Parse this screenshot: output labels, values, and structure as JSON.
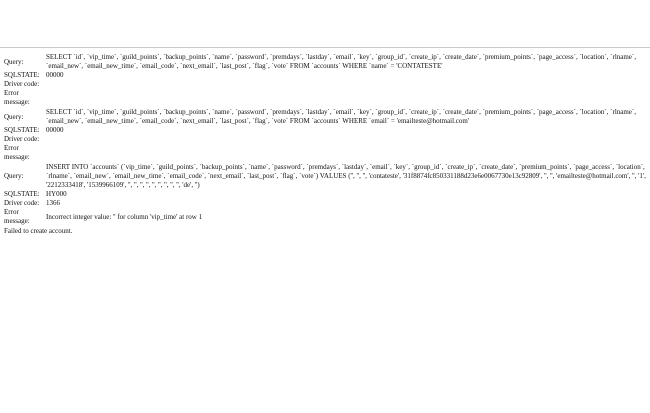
{
  "labels": {
    "query": "Query:",
    "sqlstate": "SQLSTATE:",
    "driver_code": "Driver code:",
    "error_message": "Error message:"
  },
  "blocks": [
    {
      "query": "SELECT `id`, `vip_time`, `guild_points`, `backup_points`, `name`, `password`, `premdays`, `lastday`, `email`, `key`, `group_id`, `create_ip`, `create_date`, `premium_points`, `page_access`, `location`, `rlname`, `email_new`, `email_new_time`, `email_code`, `next_email`, `last_post`, `flag`, `vote` FROM `accounts` WHERE `name` = 'CONTATESTE'",
      "sqlstate": "00000",
      "driver_code": "",
      "error_message": ""
    },
    {
      "query": "SELECT `id`, `vip_time`, `guild_points`, `backup_points`, `name`, `password`, `premdays`, `lastday`, `email`, `key`, `group_id`, `create_ip`, `create_date`, `premium_points`, `page_access`, `location`, `rlname`, `email_new`, `email_new_time`, `email_code`, `next_email`, `last_post`, `flag`, `vote` FROM `accounts` WHERE `email` = 'emailteste@hotmail.com'",
      "sqlstate": "00000",
      "driver_code": "",
      "error_message": ""
    },
    {
      "query": "INSERT INTO `accounts` (`vip_time`, `guild_points`, `backup_points`, `name`, `password`, `premdays`, `lastday`, `email`, `key`, `group_id`, `create_ip`, `create_date`, `premium_points`, `page_access`, `location`, `rlname`, `email_new`, `email_new_time`, `email_code`, `next_email`, `last_post`, `flag`, `vote`) VALUES ('', '', '', 'contateste', '31f8874fc850331188d23e6e0067730e13c92809', '', '', 'emailteste@hotmail.com', '', '1', '2212333418', '1539966109', '', '', '', '', '', '', '', '', '', 'de', '')",
      "sqlstate": "HY000",
      "driver_code": "1366",
      "error_message": "Incorrect integer value: '' for column 'vip_time' at row 1"
    }
  ],
  "failure_message": "Failed to create account."
}
